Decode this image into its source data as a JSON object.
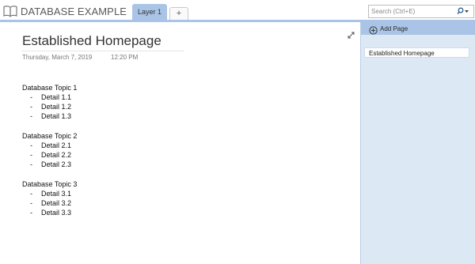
{
  "notebook": {
    "title": "DATABASE EXAMPLE",
    "icon": "notebook-icon"
  },
  "tabs": [
    {
      "label": "Layer 1",
      "active": true
    },
    {
      "label": "+",
      "active": false
    }
  ],
  "search": {
    "placeholder": "Search (Ctrl+E)",
    "value": ""
  },
  "page": {
    "title": "Established Homepage",
    "date": "Thursday, March 7, 2019",
    "time": "12:20 PM",
    "topics": [
      {
        "heading": "Database Topic 1",
        "details": [
          "Detail 1.1",
          "Detail 1.2",
          "Detail 1.3"
        ]
      },
      {
        "heading": "Database Topic 2",
        "details": [
          "Detail 2.1",
          "Detail 2.2",
          "Detail 2.3"
        ]
      },
      {
        "heading": "Database Topic 3",
        "details": [
          "Detail 3.1",
          "Detail 3.2",
          "Detail 3.3"
        ]
      }
    ],
    "bullet": "-"
  },
  "page_pane": {
    "add_page_label": "Add Page",
    "pages": [
      "Established Homepage"
    ]
  },
  "colors": {
    "accent": "#a9c4e6",
    "pane_background": "#dde8f5"
  }
}
